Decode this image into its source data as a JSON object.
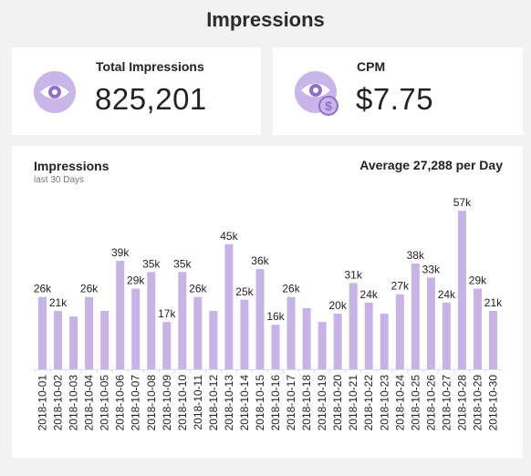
{
  "page": {
    "title": "Impressions"
  },
  "kpis": {
    "impressions": {
      "label": "Total Impressions",
      "value": "825,201",
      "icon": "eye-icon"
    },
    "cpm": {
      "label": "CPM",
      "value": "$7.75",
      "icon": "eye-dollar-icon"
    }
  },
  "colors": {
    "accent": "#c7b3e6",
    "icon_bg": "#c9b5e8",
    "icon_fg": "#8f6fc9"
  },
  "chart": {
    "title": "Impressions",
    "subtitle": "last 30 Days",
    "average_label": "Average 27,288 per Day"
  },
  "chart_data": {
    "type": "bar",
    "title": "Impressions",
    "subtitle": "last 30 Days",
    "xlabel": "",
    "ylabel": "",
    "ylim": [
      0,
      60
    ],
    "grid": false,
    "categories": [
      "2018-10-01",
      "2018-10-02",
      "2018-10-03",
      "2018-10-04",
      "2018-10-05",
      "2018-10-06",
      "2018-10-07",
      "2018-10-08",
      "2018-10-09",
      "2018-10-10",
      "2018-10-11",
      "2018-10-12",
      "2018-10-13",
      "2018-10-14",
      "2018-10-15",
      "2018-10-16",
      "2018-10-17",
      "2018-10-18",
      "2018-10-19",
      "2018-10-20",
      "2018-10-21",
      "2018-10-22",
      "2018-10-23",
      "2018-10-24",
      "2018-10-25",
      "2018-10-26",
      "2018-10-27",
      "2018-10-28",
      "2018-10-29",
      "2018-10-30"
    ],
    "values": [
      26,
      21,
      19,
      26,
      21,
      39,
      29,
      35,
      17,
      35,
      26,
      21,
      45,
      25,
      36,
      16,
      26,
      22,
      17,
      20,
      31,
      24,
      20,
      27,
      38,
      33,
      24,
      57,
      29,
      21
    ],
    "labels": [
      "26k",
      "21k",
      "",
      "26k",
      "",
      "39k",
      "29k",
      "35k",
      "17k",
      "35k",
      "26k",
      "",
      "45k",
      "25k",
      "36k",
      "16k",
      "26k",
      "",
      "",
      "20k",
      "31k",
      "24k",
      "",
      "27k",
      "38k",
      "33k",
      "24k",
      "57k",
      "29k",
      "21k"
    ],
    "units": "thousands"
  }
}
